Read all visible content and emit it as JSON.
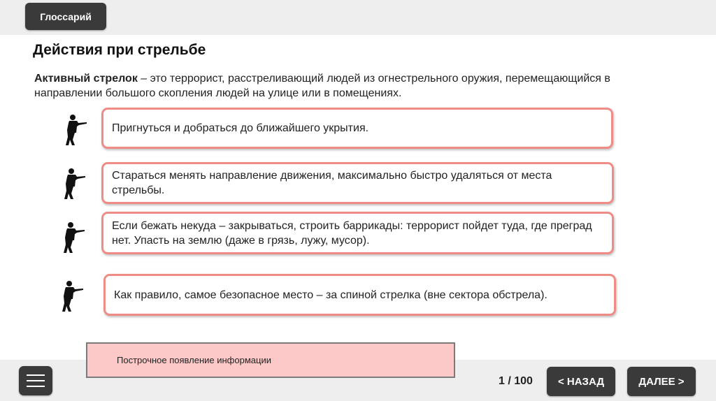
{
  "header": {
    "glossary_label": "Глоссарий"
  },
  "page": {
    "title": "Действия при стрельбе",
    "intro_term": "Активный стрелок",
    "intro_text": " – это террорист, расстреливающий людей из огнестрельного оружия, перемещающийся в направлении большого скопления людей на улице или в помещениях."
  },
  "items": [
    {
      "icon": "shooter-silhouette-icon",
      "text": "Пригнуться и добраться до ближайшего укрытия."
    },
    {
      "icon": "shooter-silhouette-icon",
      "text": "Стараться менять направление движения, максимально быстро удаляться от места стрельбы."
    },
    {
      "icon": "shooter-silhouette-icon",
      "text": "Если бежать некуда – закрываться, строить баррикады: террорист пойдет туда, где преград нет. Упасть на землю (даже в грязь, лужу, мусор)."
    },
    {
      "icon": "shooter-silhouette-icon",
      "text": "Как правило, самое безопасное место – за спиной стрелка (вне сектора обстрела)."
    }
  ],
  "note": {
    "text": "Построчное появление информации"
  },
  "footer": {
    "pager": "1 / 100",
    "back_label": "< НАЗАД",
    "next_label": "ДАЛЕЕ >",
    "menu_icon": "hamburger-menu-icon"
  },
  "colors": {
    "card_border": "#ef8c86",
    "note_bg": "#fcc8c8",
    "button_bg": "#3a3a3a",
    "bar_bg": "#eeeeee"
  }
}
